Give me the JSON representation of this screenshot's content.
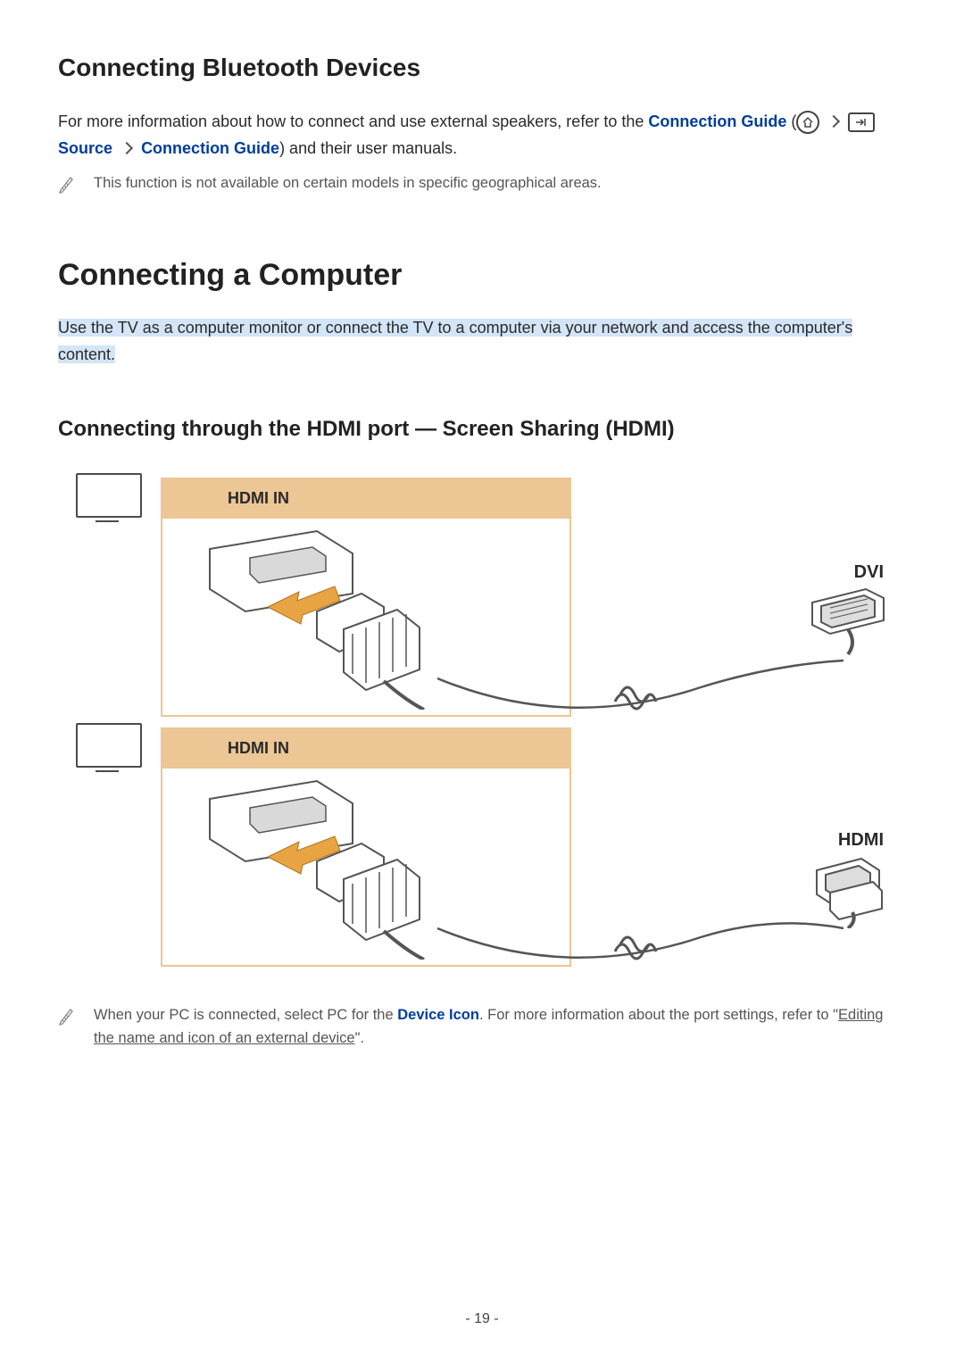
{
  "section1": {
    "title": "Connecting Bluetooth Devices",
    "para_a": "For more information about how to connect and use external speakers, refer to the ",
    "link_guide": "Connection Guide",
    "paren_open": " (",
    "link_source": "Source",
    "link_guide2": "Connection Guide",
    "paren_close": ") and their user manuals.",
    "note": "This function is not available on certain models in specific geographical areas."
  },
  "section2": {
    "title": "Connecting a Computer",
    "intro": "Use the TV as a computer monitor or connect the TV to a computer via your network and access the computer's content."
  },
  "section3": {
    "title": "Connecting through the HDMI port — Screen Sharing (HDMI)",
    "hdmi_in": "HDMI IN",
    "dvi": "DVI",
    "hdmi": "HDMI"
  },
  "note2": {
    "a": "When your PC is connected, select PC for the ",
    "device_icon": "Device Icon",
    "b": ". For more information about the port settings, refer to \"",
    "link": "Editing the name and icon of an external device",
    "c": "\"."
  },
  "page": "- 19 -"
}
